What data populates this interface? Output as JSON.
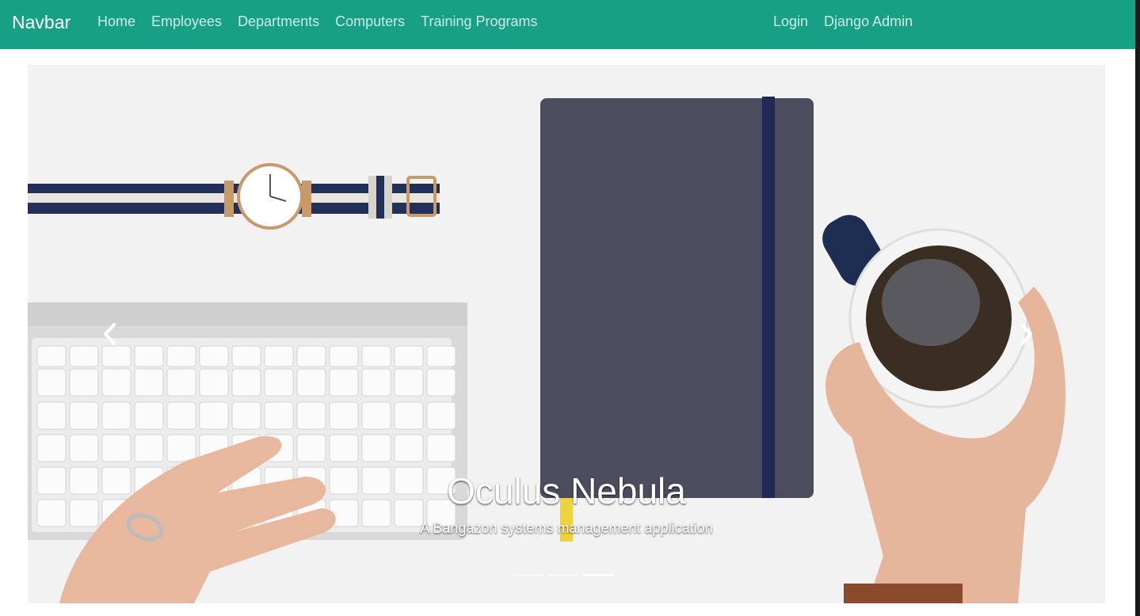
{
  "navbar": {
    "brand": "Navbar",
    "left_links": [
      "Home",
      "Employees",
      "Departments",
      "Computers",
      "Training Programs"
    ],
    "right_links": [
      "Login",
      "Django Admin"
    ],
    "color": "#18a086"
  },
  "carousel": {
    "title": "Oculus Nebula",
    "subtitle": "A Bangazon systems management application",
    "slide_count": 3,
    "active_slide": 3,
    "prev_icon": "chevron-left-icon",
    "next_icon": "chevron-right-icon"
  }
}
